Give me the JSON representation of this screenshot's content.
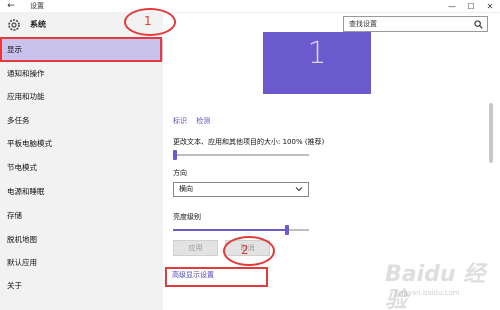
{
  "window": {
    "back_icon": "back-arrow-icon",
    "title": "设置",
    "controls": {
      "minimize": "—",
      "maximize": "☐",
      "close": "✕"
    }
  },
  "sidebar": {
    "gear_icon": "gear-icon",
    "title": "系统",
    "items": [
      {
        "label": "显示",
        "active": true
      },
      {
        "label": "通知和操作"
      },
      {
        "label": "应用和功能"
      },
      {
        "label": "多任务"
      },
      {
        "label": "平板电脑模式"
      },
      {
        "label": "节电模式"
      },
      {
        "label": "电源和睡眠"
      },
      {
        "label": "存储"
      },
      {
        "label": "脱机地图"
      },
      {
        "label": "默认应用"
      },
      {
        "label": "关于"
      }
    ]
  },
  "search": {
    "placeholder": "查找设置",
    "icon": "search-icon"
  },
  "display": {
    "monitor_number": "1",
    "links": {
      "identify": "标识",
      "detect": "检测"
    },
    "scale_label": "更改文本、应用和其他项目的大小: 100% (推荐)",
    "scale_level": 0,
    "orientation_label": "方向",
    "orientation_value": "横向",
    "brightness_label": "亮度级别",
    "brightness_level": 0.85,
    "apply_label": "应用",
    "cancel_label": "取消",
    "advanced_link": "高级显示设置"
  },
  "annotations": {
    "one": "1",
    "two": "2",
    "color": "#e23b3b"
  },
  "watermark": {
    "text": "Baidu 经验",
    "sub": "jingyan.baidu.com"
  },
  "colors": {
    "accent": "#6b5acd",
    "selected": "#c9c2ec",
    "sidebar_bg": "#f2f2f2"
  }
}
